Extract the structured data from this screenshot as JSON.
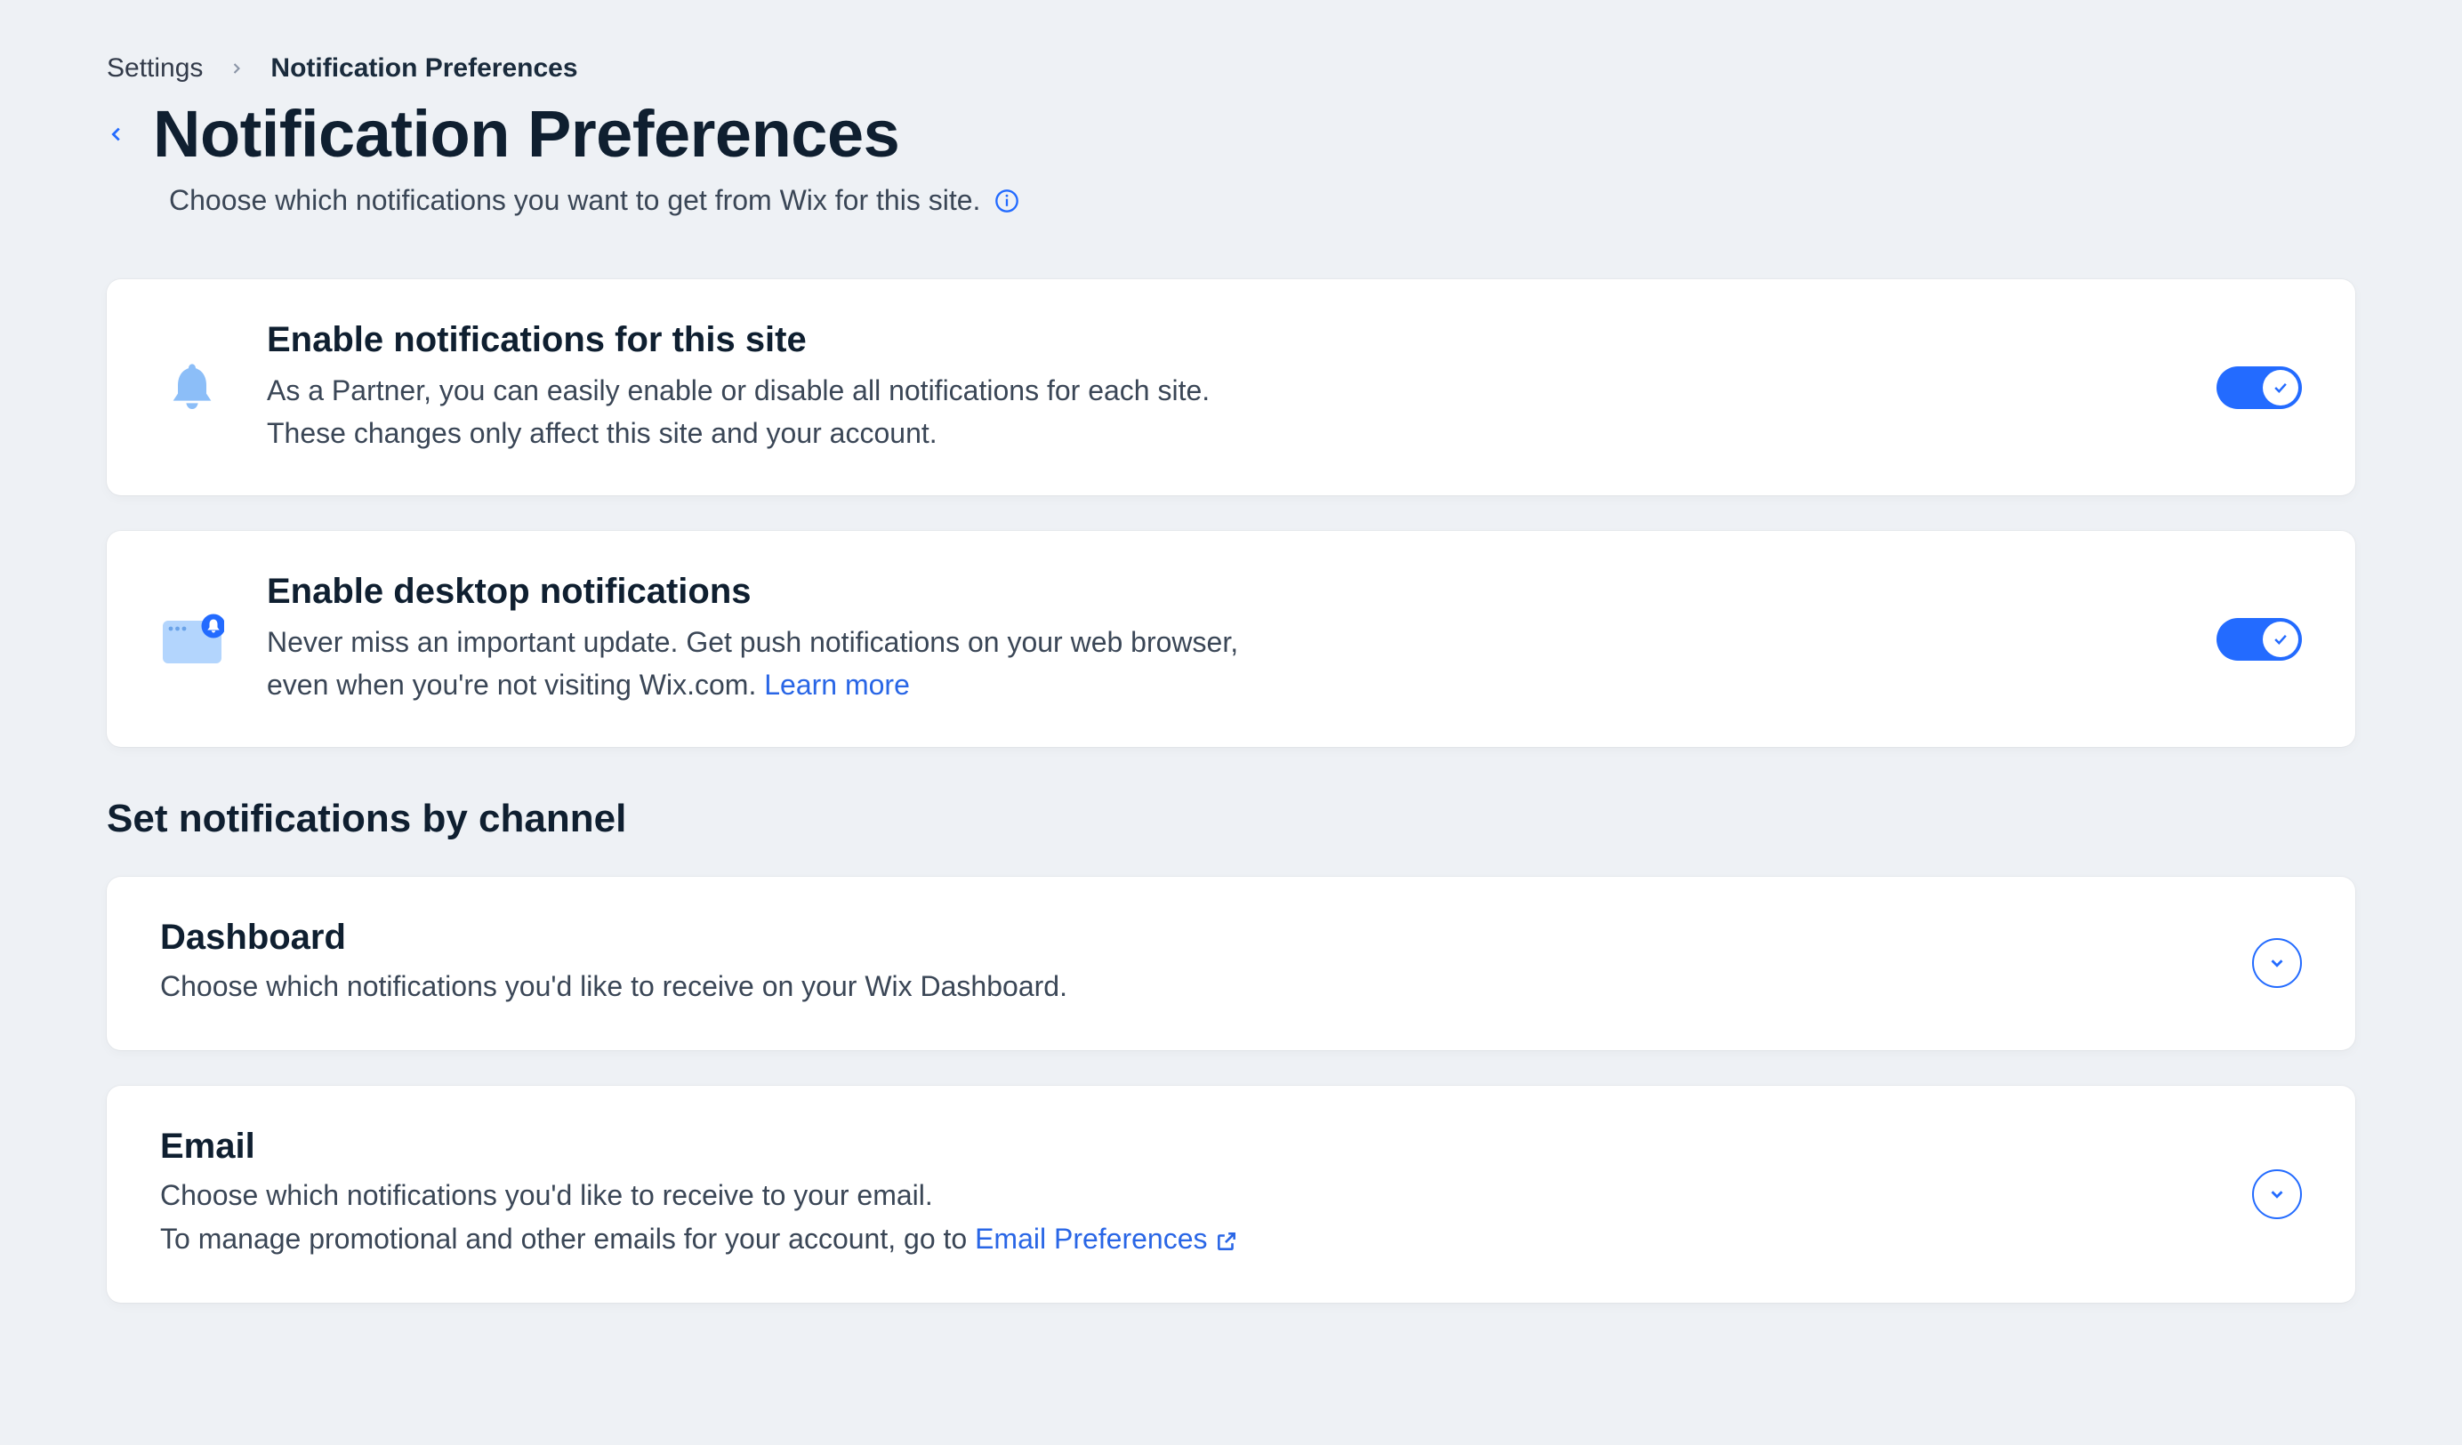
{
  "breadcrumb": {
    "root": "Settings",
    "current": "Notification Preferences"
  },
  "title": "Notification Preferences",
  "subtitle": "Choose which notifications you want to get from Wix for this site.",
  "card_site": {
    "heading": "Enable notifications for this site",
    "line1": "As a Partner, you can easily enable or disable all notifications for each site.",
    "line2": "These changes only affect this site and your account.",
    "toggle_on": true
  },
  "card_desktop": {
    "heading": "Enable desktop notifications",
    "line1": "Never miss an important update. Get push notifications on your web browser,",
    "line2_prefix": "even when you're not visiting Wix.com. ",
    "learn_more": "Learn more",
    "toggle_on": true
  },
  "channels_section_title": "Set notifications by channel",
  "channel_dashboard": {
    "heading": "Dashboard",
    "desc": "Choose which notifications you'd like to receive on your Wix Dashboard."
  },
  "channel_email": {
    "heading": "Email",
    "desc1": "Choose which notifications you'd like to receive to your email.",
    "desc2_prefix": "To manage promotional and other emails for your account, go to ",
    "link_text": "Email Preferences"
  }
}
